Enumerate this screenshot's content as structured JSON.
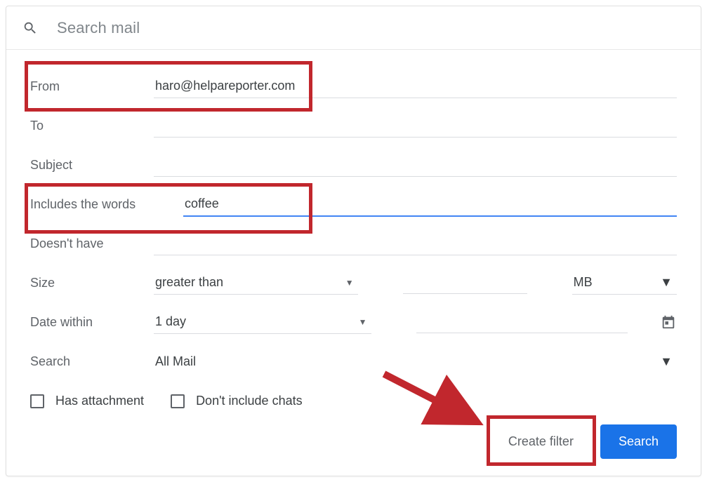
{
  "search": {
    "placeholder": "Search mail"
  },
  "fields": {
    "from": {
      "label": "From",
      "value": "haro@helpareporter.com"
    },
    "to": {
      "label": "To",
      "value": ""
    },
    "subject": {
      "label": "Subject",
      "value": ""
    },
    "includes": {
      "label": "Includes the words",
      "value": "coffee"
    },
    "doesnt": {
      "label": "Doesn't have",
      "value": ""
    }
  },
  "size": {
    "label": "Size",
    "comparator": "greater than",
    "unit": "MB"
  },
  "dateWithin": {
    "label": "Date within",
    "value": "1 day"
  },
  "searchScope": {
    "label": "Search",
    "value": "All Mail"
  },
  "checkboxes": {
    "attachment": "Has attachment",
    "noChats": "Don't include chats"
  },
  "buttons": {
    "createFilter": "Create filter",
    "search": "Search"
  }
}
